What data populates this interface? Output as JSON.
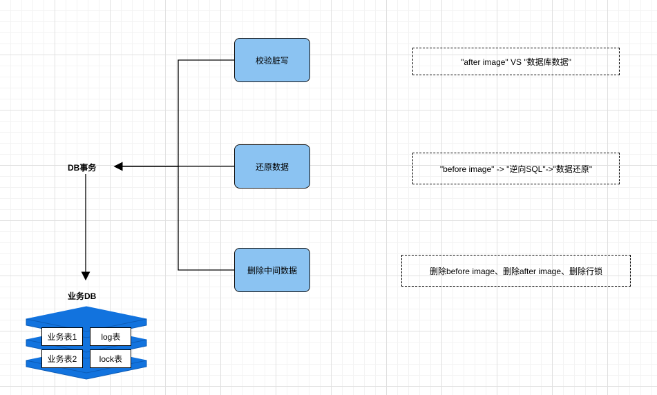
{
  "labels": {
    "db_tx": "DB事务",
    "biz_db": "业务DB"
  },
  "flow": {
    "check_dirty": "校验脏写",
    "restore_data": "还原数据",
    "delete_mid": "删除中间数据"
  },
  "notes": {
    "check_dirty": "\"after image\" VS \"数据库数据\"",
    "restore_data": "\"before image\" -> \"逆向SQL\"->\"数据还原\"",
    "delete_mid": "删除before image、删除after image、删除行锁"
  },
  "db_tables": {
    "row1": {
      "left": "业务表1",
      "right": "log表"
    },
    "row2": {
      "left": "业务表2",
      "right": "lock表"
    }
  }
}
